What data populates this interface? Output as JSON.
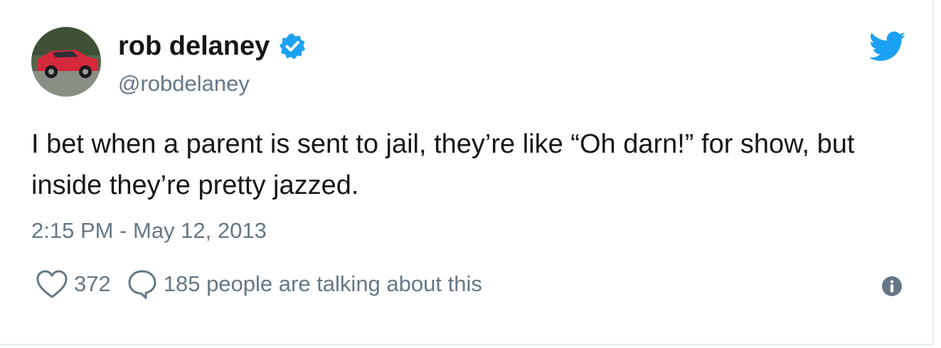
{
  "tweet": {
    "author": {
      "display_name": "rob delaney",
      "handle": "@robdelaney",
      "verified": true,
      "avatar": "avatar-photo-red-car"
    },
    "text": "I bet when a parent is sent to jail, they’re like “Oh darn!” for show, but inside they’re pretty jazzed.",
    "timestamp": "2:15 PM - May 12, 2013",
    "likes_count": "372",
    "talking_text": "185 people are talking about this"
  },
  "icons": {
    "brand": "twitter-bird-icon",
    "verified": "verified-badge-icon",
    "like": "heart-icon",
    "reply": "speech-bubble-icon",
    "info": "info-icon"
  },
  "colors": {
    "brand_blue": "#1da1f2",
    "text_primary": "#14171a",
    "text_secondary": "#657786",
    "border": "#e6ecf0"
  }
}
